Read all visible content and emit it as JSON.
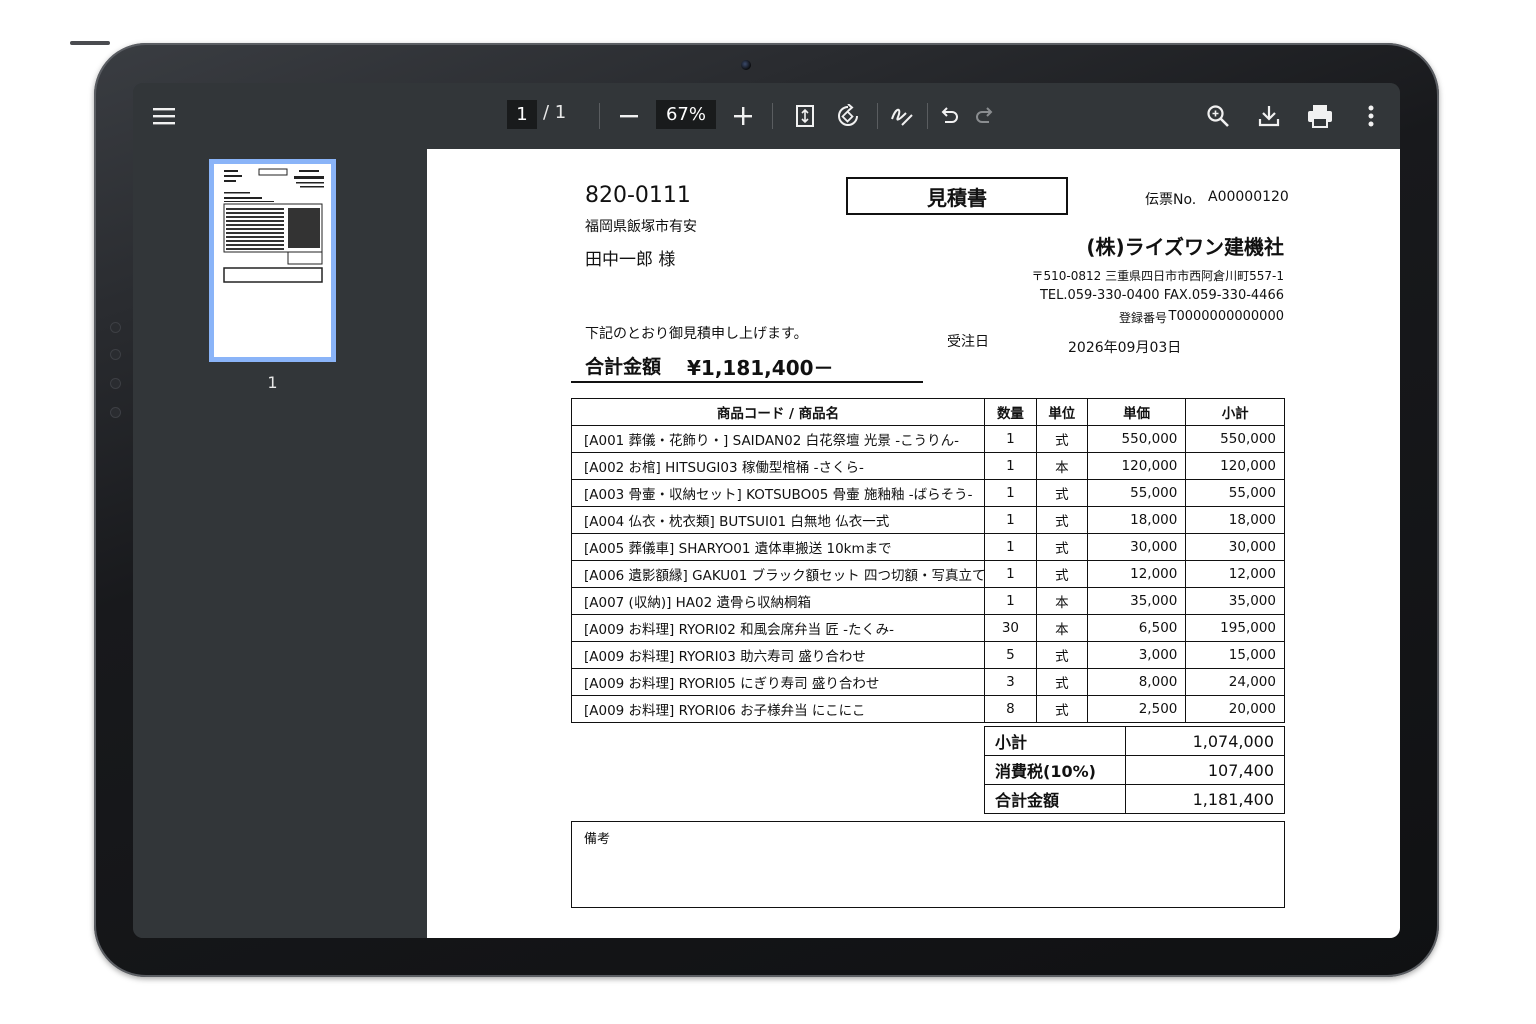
{
  "toolbar": {
    "menu_icon": "hamburger-icon",
    "current_page": "1",
    "page_total": "/ 1",
    "zoom": "67%",
    "icons": [
      "zoom-out-icon",
      "zoom-in-icon",
      "fit-page-icon",
      "rotate-icon",
      "annotate-icon",
      "undo-icon",
      "redo-icon",
      "search-icon",
      "download-icon",
      "print-icon",
      "more-vert-icon"
    ]
  },
  "sidebar": {
    "thumbnail_page_label": "1"
  },
  "document": {
    "postal_code": "820-0111",
    "customer_address": "福岡県飯塚市有安",
    "customer_name": "田中一郎 様",
    "title": "見積書",
    "slip_no_label": "伝票No.",
    "slip_no": "A00000120",
    "company_name": "(株)ライズワン建機社",
    "company_address": "〒510-0812 三重県四日市市西阿倉川町557-1",
    "company_tel_fax": "TEL.059-330-0400 FAX.059-330-4466",
    "registration_label": "登録番号",
    "registration_no": "T0000000000000",
    "intro_text": "下記のとおり御見積申し上げます。",
    "total_label": "合計金額",
    "total_value": "¥1,181,400－",
    "order_date_label": "受注日",
    "order_date": "2026年09月03日",
    "table_headers": [
      "商品コード / 商品名",
      "数量",
      "単位",
      "単価",
      "小計"
    ],
    "items": [
      {
        "name": "[A001 葬儀・花飾り・] SAIDAN02 白花祭壇 光景 -こうりん-",
        "qty": "1",
        "unit": "式",
        "price": "550,000",
        "subtotal": "550,000"
      },
      {
        "name": "[A002 お棺] HITSUGI03 稼働型棺桶 -さくら-",
        "qty": "1",
        "unit": "本",
        "price": "120,000",
        "subtotal": "120,000"
      },
      {
        "name": "[A003 骨壷・収納セット] KOTSUBO05 骨壷 施釉釉 -ばらそう-",
        "qty": "1",
        "unit": "式",
        "price": "55,000",
        "subtotal": "55,000"
      },
      {
        "name": "[A004 仏衣・枕衣類] BUTSUI01 白無地 仏衣一式",
        "qty": "1",
        "unit": "式",
        "price": "18,000",
        "subtotal": "18,000"
      },
      {
        "name": "[A005 葬儀車] SHARYO01 遺体車搬送 10kmまで",
        "qty": "1",
        "unit": "式",
        "price": "30,000",
        "subtotal": "30,000"
      },
      {
        "name": "[A006 遺影額縁] GAKU01 ブラック額セット 四つ切額・写真立て",
        "qty": "1",
        "unit": "式",
        "price": "12,000",
        "subtotal": "12,000"
      },
      {
        "name": "[A007 (収納)] HA02 遺骨ら収納桐箱",
        "qty": "1",
        "unit": "本",
        "price": "35,000",
        "subtotal": "35,000"
      },
      {
        "name": "[A009 お料理] RYORI02 和風会席弁当 匠 -たくみ-",
        "qty": "30",
        "unit": "本",
        "price": "6,500",
        "subtotal": "195,000"
      },
      {
        "name": "[A009 お料理] RYORI03 助六寿司 盛り合わせ",
        "qty": "5",
        "unit": "式",
        "price": "3,000",
        "subtotal": "15,000"
      },
      {
        "name": "[A009 お料理] RYORI05 にぎり寿司 盛り合わせ",
        "qty": "3",
        "unit": "式",
        "price": "8,000",
        "subtotal": "24,000"
      },
      {
        "name": "[A009 お料理] RYORI06 お子様弁当 にこにこ",
        "qty": "8",
        "unit": "式",
        "price": "2,500",
        "subtotal": "20,000"
      }
    ],
    "summary": [
      {
        "label": "小計",
        "value": "1,074,000"
      },
      {
        "label": "消費税(10%)",
        "value": "107,400"
      },
      {
        "label": "合計金額",
        "value": "1,181,400"
      }
    ],
    "remarks_label": "備考"
  }
}
